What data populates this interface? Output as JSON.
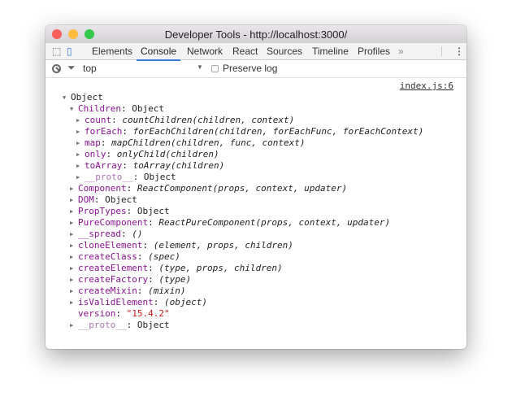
{
  "window": {
    "title": "Developer Tools - http://localhost:3000/"
  },
  "tabs": [
    "Elements",
    "Console",
    "Network",
    "React",
    "Sources",
    "Timeline",
    "Profiles"
  ],
  "active_tab": "Console",
  "more_tabs": "»",
  "filter": {
    "context": "top",
    "preserve_log": "Preserve log",
    "preserve_checked": false
  },
  "source_link": "index.js:6",
  "tree": [
    {
      "level": 0,
      "arrow": "▼",
      "key": "",
      "value": "Object",
      "vtype": "v"
    },
    {
      "level": 1,
      "arrow": "▼",
      "key": "Children",
      "value": "Object",
      "vtype": "v"
    },
    {
      "level": 2,
      "arrow": "▶",
      "key": "count",
      "value": "countChildren(children, context)",
      "vtype": "i"
    },
    {
      "level": 2,
      "arrow": "▶",
      "key": "forEach",
      "value": "forEachChildren(children, forEachFunc, forEachContext)",
      "vtype": "i"
    },
    {
      "level": 2,
      "arrow": "▶",
      "key": "map",
      "value": "mapChildren(children, func, context)",
      "vtype": "i"
    },
    {
      "level": 2,
      "arrow": "▶",
      "key": "only",
      "value": "onlyChild(children)",
      "vtype": "i"
    },
    {
      "level": 2,
      "arrow": "▶",
      "key": "toArray",
      "value": "toArray(children)",
      "vtype": "i"
    },
    {
      "level": 2,
      "arrow": "▶",
      "key": "__proto__",
      "value": "Object",
      "vtype": "v",
      "dim": true
    },
    {
      "level": 1,
      "arrow": "▶",
      "key": "Component",
      "value": "ReactComponent(props, context, updater)",
      "vtype": "i"
    },
    {
      "level": 1,
      "arrow": "▶",
      "key": "DOM",
      "value": "Object",
      "vtype": "v"
    },
    {
      "level": 1,
      "arrow": "▶",
      "key": "PropTypes",
      "value": "Object",
      "vtype": "v"
    },
    {
      "level": 1,
      "arrow": "▶",
      "key": "PureComponent",
      "value": "ReactPureComponent(props, context, updater)",
      "vtype": "i"
    },
    {
      "level": 1,
      "arrow": "▶",
      "key": "__spread",
      "value": "()",
      "vtype": "i"
    },
    {
      "level": 1,
      "arrow": "▶",
      "key": "cloneElement",
      "value": "(element, props, children)",
      "vtype": "i"
    },
    {
      "level": 1,
      "arrow": "▶",
      "key": "createClass",
      "value": "(spec)",
      "vtype": "i"
    },
    {
      "level": 1,
      "arrow": "▶",
      "key": "createElement",
      "value": "(type, props, children)",
      "vtype": "i"
    },
    {
      "level": 1,
      "arrow": "▶",
      "key": "createFactory",
      "value": "(type)",
      "vtype": "i"
    },
    {
      "level": 1,
      "arrow": "▶",
      "key": "createMixin",
      "value": "(mixin)",
      "vtype": "i"
    },
    {
      "level": 1,
      "arrow": "▶",
      "key": "isValidElement",
      "value": "(object)",
      "vtype": "i"
    },
    {
      "level": 1,
      "arrow": "",
      "key": "version",
      "value": "\"15.4.2\"",
      "vtype": "s"
    },
    {
      "level": 1,
      "arrow": "▶",
      "key": "__proto__",
      "value": "Object",
      "vtype": "v",
      "dim": true
    }
  ],
  "prompt": "›"
}
